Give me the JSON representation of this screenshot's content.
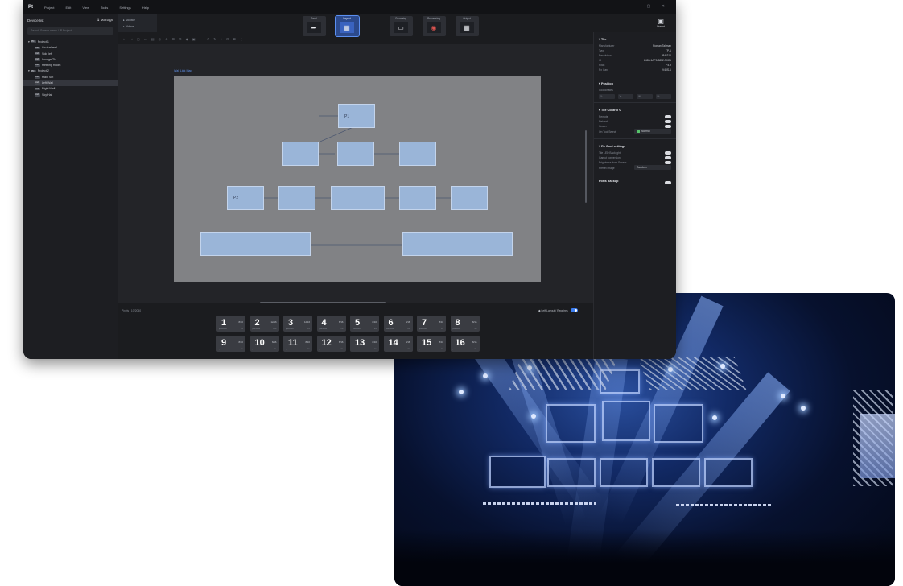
{
  "app": {
    "logo": "Pt",
    "menu": [
      "Project",
      "Edit",
      "View",
      "Tools",
      "Settings",
      "Help"
    ],
    "window_controls": "—  ▢  ✕"
  },
  "device_list": {
    "title": "Device list",
    "manage_label": "Manage",
    "search_placeholder": "Search Screen name / IP Project",
    "projects": [
      {
        "name": "Project 1",
        "screens": [
          "Central wall",
          "Side left",
          "Lounge TV",
          "Meeting Room"
        ]
      },
      {
        "name": "Project 2",
        "screens": [
          "Main Set",
          "Left Wall",
          "Right Wall",
          "Sky Hall"
        ]
      }
    ],
    "selected_screen": "Left Wall"
  },
  "modes": [
    "Monitor",
    "Videos"
  ],
  "toolbar": {
    "tools": [
      {
        "label": "Send",
        "glyph": "➡",
        "active": false
      },
      {
        "label": "Layout",
        "glyph": "▦",
        "active": true
      },
      {
        "label": "Geometry",
        "glyph": "▭",
        "active": false
      },
      {
        "label": "Processing",
        "glyph": "◉",
        "active": false
      },
      {
        "label": "Output",
        "glyph": "▦",
        "active": false
      }
    ],
    "preset_label": "Preset",
    "preset_glyph": "▣"
  },
  "edit_tools": "⇤ ⇥ ▢ ▭ ▤ ◎ ⊕ ⊞ ⊟ ◆ ▣ ⋯ ↺ ↻ ⌖ ⊡ ⊠ ⋮",
  "canvas": {
    "label": "Wall Link Map",
    "screen_labels": [
      "P1",
      "P2"
    ]
  },
  "inspector": {
    "tile": {
      "title": "Tile",
      "rows": [
        [
          "Manufacturer",
          "Roman Tallman"
        ],
        [
          "Type",
          "TP-1"
        ],
        [
          "Resolution",
          "384*216"
        ],
        [
          "ID",
          "2483-1AF5-8852-F0C1"
        ],
        [
          "Pitch",
          "P3.9"
        ],
        [
          "Rx Card",
          "V40S-1"
        ]
      ]
    },
    "position": {
      "title": "Position",
      "coord_label": "Coordinates",
      "coords": [
        "X:",
        "Y:",
        "W:",
        "H:"
      ]
    },
    "tile_control": {
      "title": "Tile Control",
      "rows": [
        "Remote",
        "Network",
        "Heater"
      ],
      "on_tool_label": "On Tool Select",
      "on_tool_value": "Normal"
    },
    "rx_card": {
      "title": "Rx Card settings",
      "rows": [
        "Tile LED Backlight",
        "Gamut conversion",
        "Brightness from Sensor"
      ],
      "preset_label": "Preset Image",
      "preset_value": "Random"
    },
    "ports_backup": "Ports Backup"
  },
  "status": {
    "pixels": "Pixels : 10/2040",
    "right_label": "◆ Left Layout / Requires"
  },
  "presets": [
    {
      "n": "1",
      "t": "8/16",
      "s": "processor",
      "r": "3%"
    },
    {
      "n": "2",
      "t": "12/16",
      "s": "processor",
      "r": "38%"
    },
    {
      "n": "3",
      "t": "12/16",
      "s": "processor",
      "r": "71%"
    },
    {
      "n": "4",
      "t": "8/16",
      "s": "processor",
      "r": "2%"
    },
    {
      "n": "5",
      "t": "8/16",
      "s": "processor",
      "r": "5%"
    },
    {
      "n": "6",
      "t": "8/16",
      "s": "processor",
      "r": "0%"
    },
    {
      "n": "7",
      "t": "8/16",
      "s": "processor",
      "r": "1%"
    },
    {
      "n": "8",
      "t": "8/16",
      "s": "processor",
      "r": "3%"
    },
    {
      "n": "9",
      "t": "8/16",
      "s": "processor",
      "r": "3%"
    },
    {
      "n": "10",
      "t": "8/16",
      "s": "processor",
      "r": "3%"
    },
    {
      "n": "11",
      "t": "8/16",
      "s": "processor",
      "r": "3%"
    },
    {
      "n": "12",
      "t": "8/16",
      "s": "processor",
      "r": "3%"
    },
    {
      "n": "13",
      "t": "8/16",
      "s": "processor",
      "r": "3%"
    },
    {
      "n": "14",
      "t": "8/16",
      "s": "processor",
      "r": "3%"
    },
    {
      "n": "15",
      "t": "8/16",
      "s": "processor",
      "r": "3%"
    },
    {
      "n": "16",
      "t": "8/16",
      "s": "processor",
      "r": "3%"
    }
  ]
}
